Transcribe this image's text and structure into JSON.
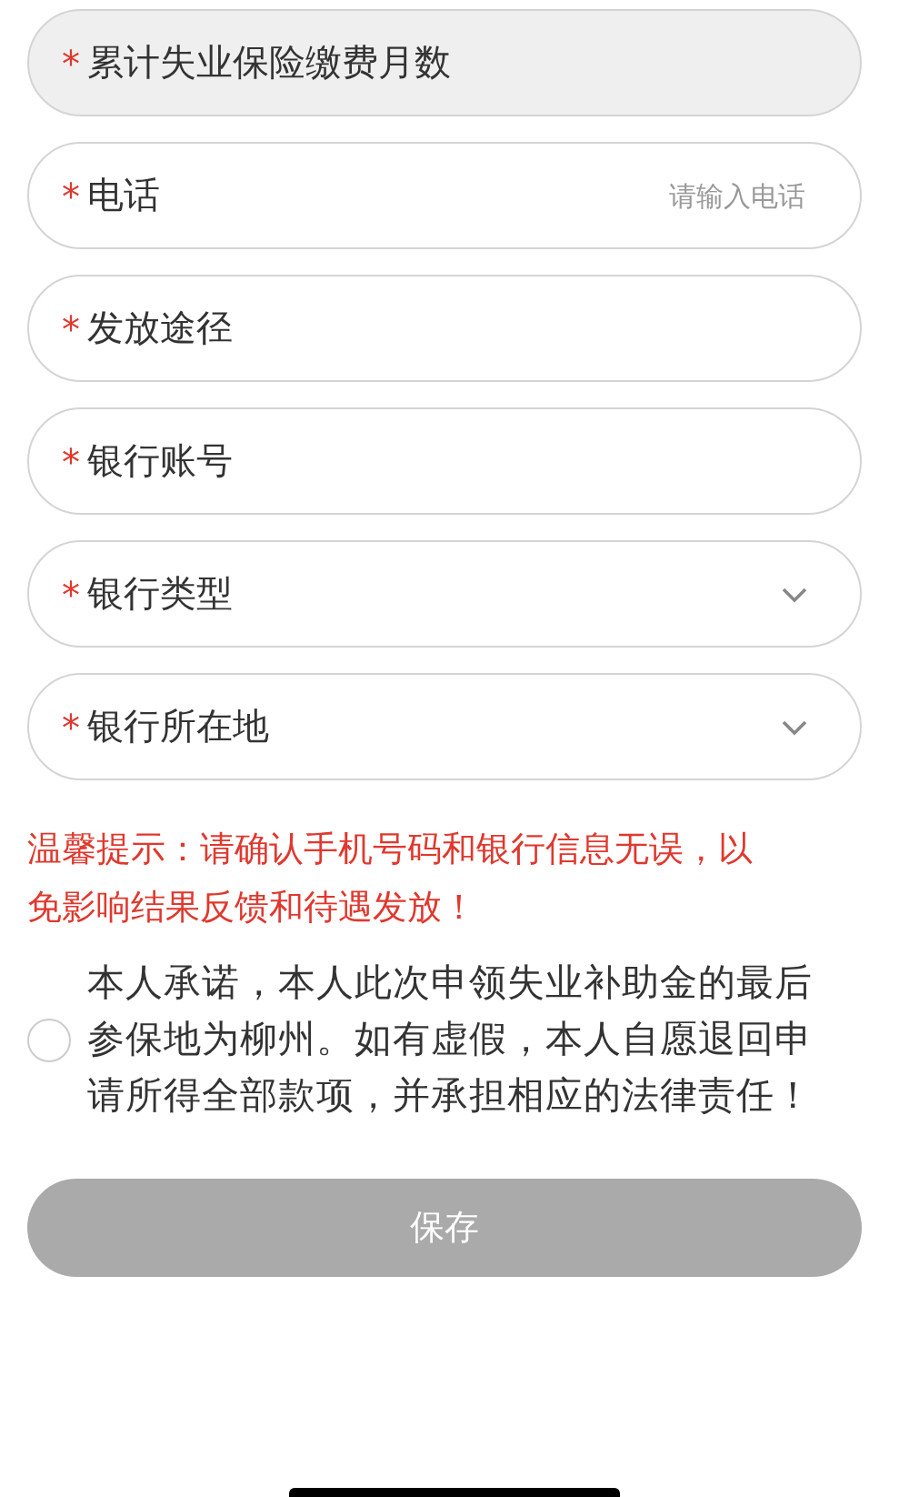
{
  "fields": [
    {
      "kind": "text",
      "required_mark": "*",
      "label": "累计失业保险缴费月数",
      "disabled": true
    },
    {
      "kind": "text",
      "required_mark": "*",
      "label": "电话",
      "placeholder": "请输入电话",
      "disabled": false
    },
    {
      "kind": "text",
      "required_mark": "*",
      "label": "发放途径",
      "disabled": false
    },
    {
      "kind": "text",
      "required_mark": "*",
      "label": "银行账号",
      "disabled": false
    },
    {
      "kind": "select",
      "required_mark": "*",
      "label": "银行类型",
      "disabled": false
    },
    {
      "kind": "select",
      "required_mark": "*",
      "label": "银行所在地",
      "disabled": false
    }
  ],
  "notice": "温馨提示：请确认手机号码和银行信息无误，以免影响结果反馈和待遇发放！",
  "agreement": {
    "checked": false,
    "text": "本人承诺，本人此次申领失业补助金的最后参保地为柳州。如有虚假，本人自愿退回申请所得全部款项，并承担相应的法律责任！"
  },
  "save_button": {
    "label": "保存",
    "disabled": true
  }
}
